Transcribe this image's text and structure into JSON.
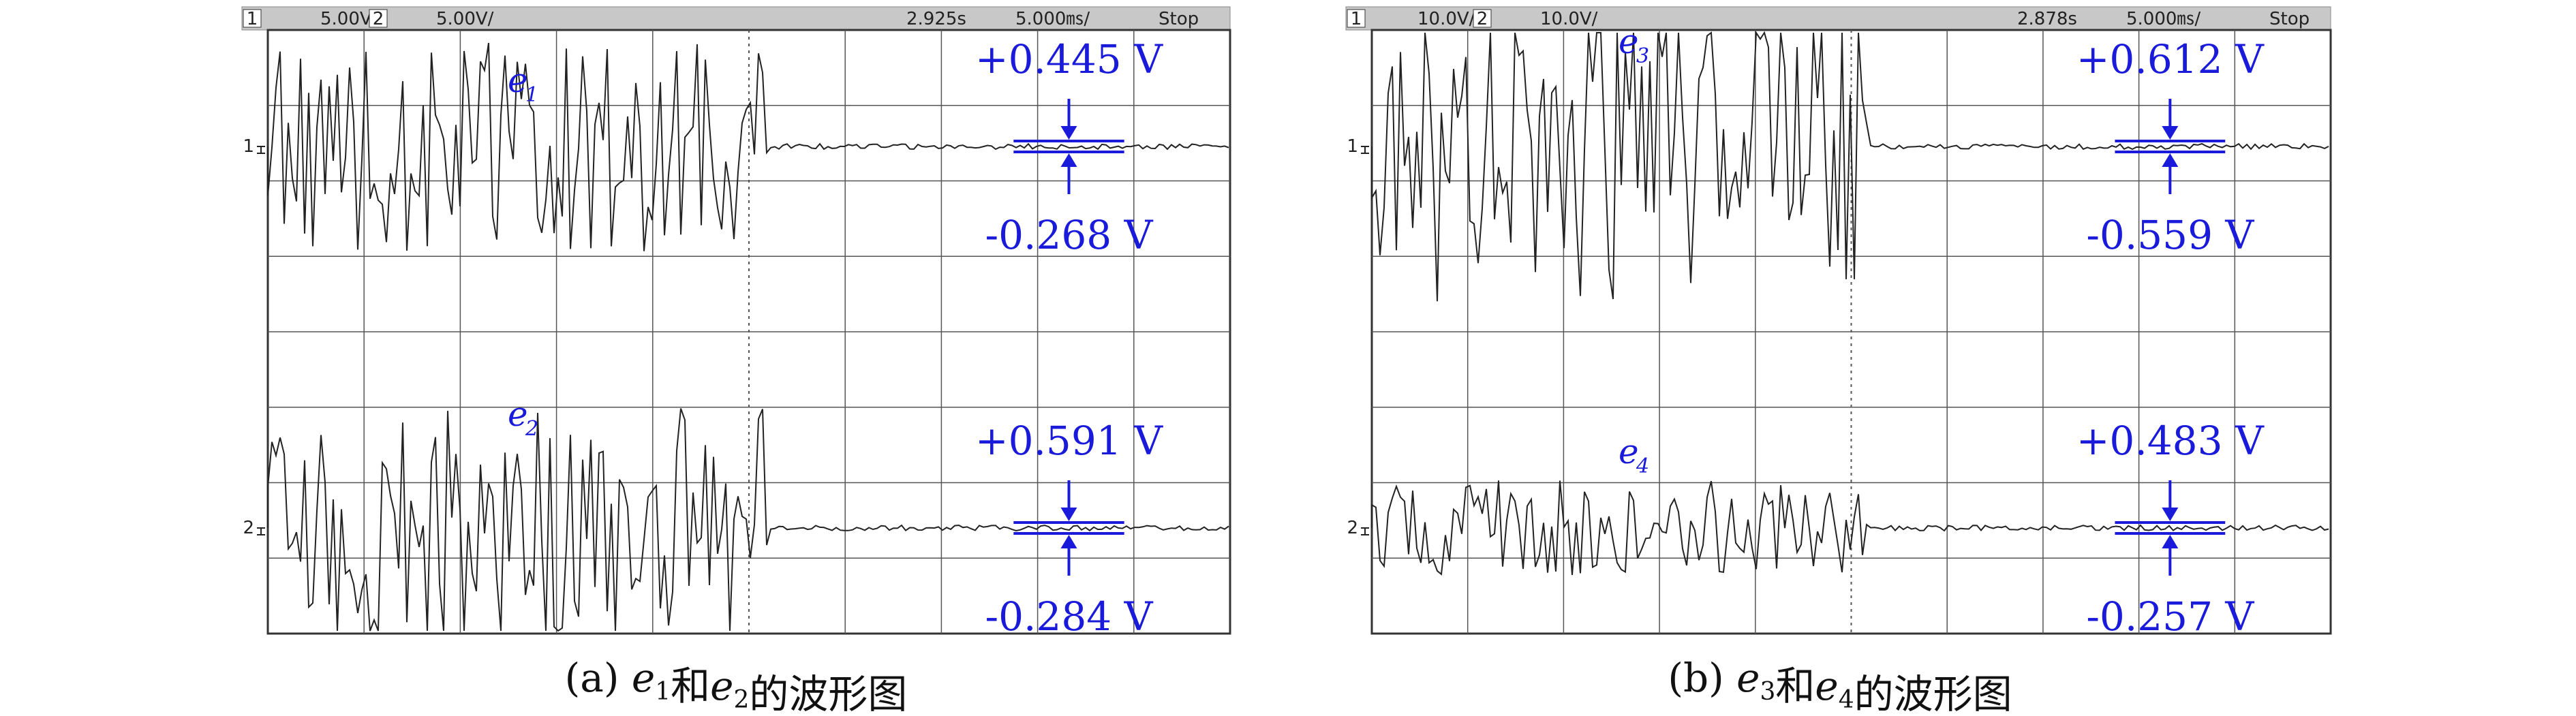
{
  "panels": [
    {
      "header": {
        "ch1_num": "1",
        "ch1_scale": "5.00V/",
        "ch2_num": "2",
        "ch2_scale": "5.00V/",
        "time": "2.925s",
        "timebase": "5.000㎳/",
        "mode": "Stop"
      },
      "traces": [
        {
          "label_base": "e",
          "label_sub": "1",
          "marker": "1",
          "pos_text": "+0.445 V",
          "neg_text": "-0.268 V"
        },
        {
          "label_base": "e",
          "label_sub": "2",
          "marker": "2",
          "pos_text": "+0.591 V",
          "neg_text": "-0.284 V"
        }
      ],
      "caption": {
        "prefix": "(a)",
        "v1": "e",
        "s1": "1",
        "mid": "和",
        "v2": "e",
        "s2": "2",
        "suffix": "的波形图"
      }
    },
    {
      "header": {
        "ch1_num": "1",
        "ch1_scale": "10.0V/",
        "ch2_num": "2",
        "ch2_scale": "10.0V/",
        "time": "2.878s",
        "timebase": "5.000㎳/",
        "mode": "Stop"
      },
      "traces": [
        {
          "label_base": "e",
          "label_sub": "3",
          "marker": "1",
          "pos_text": "+0.612 V",
          "neg_text": "-0.559 V"
        },
        {
          "label_base": "e",
          "label_sub": "4",
          "marker": "2",
          "pos_text": "+0.483 V",
          "neg_text": "-0.257 V"
        }
      ],
      "caption": {
        "prefix": "(b)",
        "v1": "e",
        "s1": "3",
        "mid": "和",
        "v2": "e",
        "s2": "4",
        "suffix": "的波形图"
      }
    }
  ],
  "chart_data": [
    {
      "type": "line",
      "series": [
        {
          "name": "e1",
          "peak_positive": 0.445,
          "peak_negative": -0.268
        },
        {
          "name": "e2",
          "peak_positive": 0.591,
          "peak_negative": -0.284
        }
      ],
      "grid": true
    },
    {
      "type": "line",
      "series": [
        {
          "name": "e3",
          "peak_positive": 0.612,
          "peak_negative": -0.559
        },
        {
          "name": "e4",
          "peak_positive": 0.483,
          "peak_negative": -0.257
        }
      ],
      "grid": true
    }
  ],
  "style": {
    "annotation_color": "#1a1adb",
    "trace_color": "#222222",
    "grid_color": "#555555",
    "header_bg": "#c8c8c8"
  }
}
